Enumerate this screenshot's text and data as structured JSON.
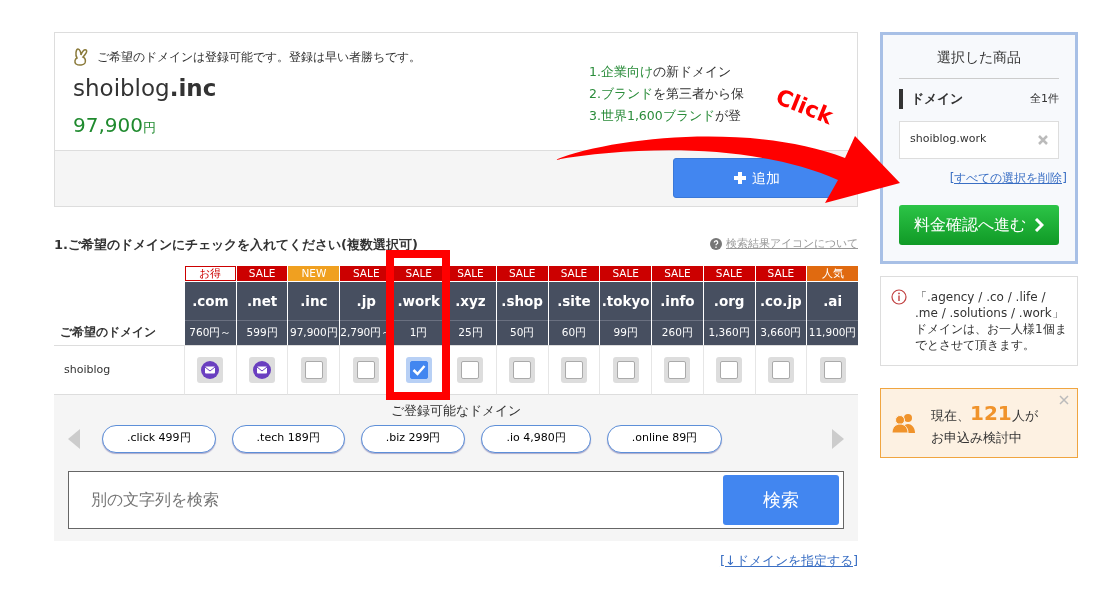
{
  "availability": {
    "message": "ご希望のドメインは登録可能です。登録は早い者勝ちです。",
    "name": "shoiblog",
    "tld": ".inc",
    "price": "97,900",
    "currency": "円",
    "features": [
      {
        "highlight": "1.企業向け",
        "rest": "の新ドメイン"
      },
      {
        "highlight": "2.ブランド",
        "rest": "を第三者から保"
      },
      {
        "highlight": "3.世界1,600ブランド",
        "rest": "が登"
      }
    ],
    "add_button": "追加"
  },
  "domain_section": {
    "heading": "1.ご希望のドメインにチェックを入れてください(複数選択可)",
    "help_link": "検索結果アイコンについて",
    "row_label": "ご希望のドメイン",
    "row_name": "shoiblog",
    "domains": [
      {
        "tld": ".com",
        "badge": "お得",
        "color": "#cc0000",
        "outlined": true,
        "price": "760円～",
        "kind": "taken"
      },
      {
        "tld": ".net",
        "badge": "SALE",
        "color": "#cc0000",
        "outlined": false,
        "price": "599円",
        "kind": "taken"
      },
      {
        "tld": ".inc",
        "badge": "NEW",
        "color": "#f0a020",
        "outlined": false,
        "price": "97,900円",
        "kind": "checkbox",
        "checked": false
      },
      {
        "tld": ".jp",
        "badge": "SALE",
        "color": "#cc0000",
        "outlined": false,
        "price": "2,790円～",
        "kind": "checkbox",
        "checked": false
      },
      {
        "tld": ".work",
        "badge": "SALE",
        "color": "#cc0000",
        "outlined": false,
        "price": "1円",
        "kind": "checkbox",
        "checked": true
      },
      {
        "tld": ".xyz",
        "badge": "SALE",
        "color": "#cc0000",
        "outlined": false,
        "price": "25円",
        "kind": "checkbox",
        "checked": false
      },
      {
        "tld": ".shop",
        "badge": "SALE",
        "color": "#cc0000",
        "outlined": false,
        "price": "50円",
        "kind": "checkbox",
        "checked": false
      },
      {
        "tld": ".site",
        "badge": "SALE",
        "color": "#cc0000",
        "outlined": false,
        "price": "60円",
        "kind": "checkbox",
        "checked": false
      },
      {
        "tld": ".tokyo",
        "badge": "SALE",
        "color": "#cc0000",
        "outlined": false,
        "price": "99円",
        "kind": "checkbox",
        "checked": false
      },
      {
        "tld": ".info",
        "badge": "SALE",
        "color": "#cc0000",
        "outlined": false,
        "price": "260円",
        "kind": "checkbox",
        "checked": false
      },
      {
        "tld": ".org",
        "badge": "SALE",
        "color": "#cc0000",
        "outlined": false,
        "price": "1,360円",
        "kind": "checkbox",
        "checked": false
      },
      {
        "tld": ".co.jp",
        "badge": "SALE",
        "color": "#cc0000",
        "outlined": false,
        "price": "3,660円",
        "kind": "checkbox",
        "checked": false
      },
      {
        "tld": ".ai",
        "badge": "人気",
        "color": "#e06a10",
        "outlined": false,
        "price": "11,900円",
        "kind": "checkbox",
        "checked": false
      }
    ],
    "suggestions_title": "ご登録可能なドメイン",
    "suggestions": [
      ".click 499円",
      ".tech 189円",
      ".biz 299円",
      ".io 4,980円",
      ".online 89円"
    ],
    "search": {
      "placeholder": "別の文字列を検索",
      "button": "検索"
    },
    "specify_link": "[↓ドメインを指定する]"
  },
  "cart": {
    "title": "選択した商品",
    "section": "ドメイン",
    "count": "全1件",
    "items": [
      "shoiblog.work"
    ],
    "clear_link": "[すべての選択を削除]",
    "proceed_button": "料金確認へ進む"
  },
  "notice": "「.agency / .co / .life / .me / .solutions / .work」ドメインは、お一人様1個までとさせて頂きます。",
  "viewers": {
    "prefix": "現在、",
    "count": "121",
    "suffix": "人が",
    "line2": "お申込み検討中"
  },
  "annotation": {
    "label": "Click"
  }
}
